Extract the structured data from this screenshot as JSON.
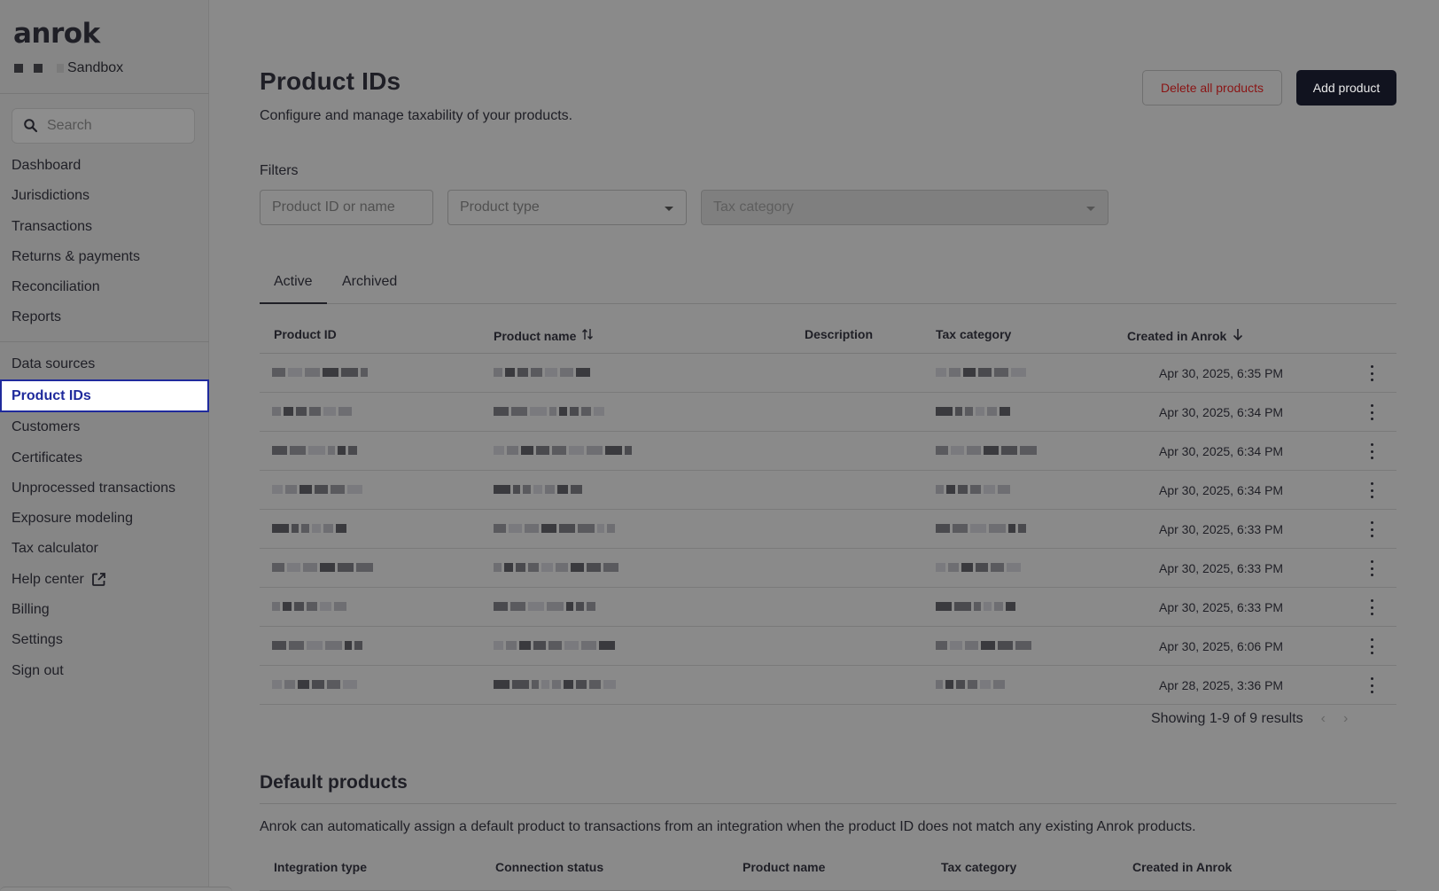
{
  "app": {
    "logo": "anrok",
    "org_label": "Sandbox"
  },
  "sidebar": {
    "search_placeholder": "Search",
    "items": [
      {
        "label": "Dashboard"
      },
      {
        "label": "Jurisdictions"
      },
      {
        "label": "Transactions"
      },
      {
        "label": "Returns & payments"
      },
      {
        "label": "Reconciliation"
      },
      {
        "label": "Reports"
      },
      {
        "label": "Data sources"
      },
      {
        "label": "Product IDs",
        "active": true
      },
      {
        "label": "Customers"
      },
      {
        "label": "Certificates"
      },
      {
        "label": "Unprocessed transactions"
      },
      {
        "label": "Exposure modeling"
      },
      {
        "label": "Tax calculator"
      },
      {
        "label": "Help center",
        "icon": "external-link-icon"
      },
      {
        "label": "Billing"
      },
      {
        "label": "Settings"
      },
      {
        "label": "Sign out"
      }
    ]
  },
  "header": {
    "title": "Product IDs",
    "subtitle": "Configure and manage taxability of your products.",
    "delete_all_label": "Delete all products",
    "add_product_label": "Add product"
  },
  "filters": {
    "label": "Filters",
    "product_id_placeholder": "Product ID or name",
    "product_type_placeholder": "Product type",
    "tax_category_placeholder": "Tax category"
  },
  "tabs": [
    {
      "label": "Active",
      "active": true
    },
    {
      "label": "Archived"
    }
  ],
  "table": {
    "columns": [
      "Product ID",
      "Product name",
      "Description",
      "Tax category",
      "Created in Anrok"
    ],
    "rows": [
      {
        "created": "Apr 30, 2025, 6:35 PM"
      },
      {
        "created": "Apr 30, 2025, 6:34 PM"
      },
      {
        "created": "Apr 30, 2025, 6:34 PM"
      },
      {
        "created": "Apr 30, 2025, 6:34 PM"
      },
      {
        "created": "Apr 30, 2025, 6:33 PM"
      },
      {
        "created": "Apr 30, 2025, 6:33 PM"
      },
      {
        "created": "Apr 30, 2025, 6:33 PM"
      },
      {
        "created": "Apr 30, 2025, 6:06 PM"
      },
      {
        "created": "Apr 28, 2025, 3:36 PM"
      }
    ],
    "pagination": "Showing 1-9 of 9 results"
  },
  "default_products": {
    "title": "Default products",
    "description": "Anrok can automatically assign a default product to transactions from an integration when the product ID does not match any existing Anrok products.",
    "columns": [
      "Integration type",
      "Connection status",
      "Product name",
      "Tax category",
      "Created in Anrok"
    ]
  },
  "colors": {
    "accent": "#1f2a9c",
    "danger": "#8a1414",
    "primary_button": "#11131f"
  }
}
